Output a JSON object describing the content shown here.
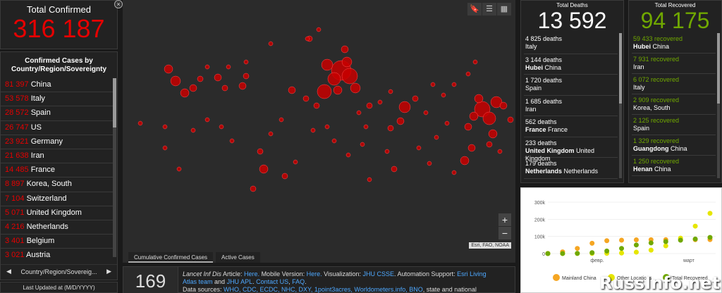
{
  "total_confirmed": {
    "label": "Total Confirmed",
    "value": "316 187"
  },
  "cases": {
    "header": "Confirmed Cases by Country/Region/Sovereignty",
    "rows": [
      {
        "n": "81 397",
        "c": "China"
      },
      {
        "n": "53 578",
        "c": "Italy"
      },
      {
        "n": "28 572",
        "c": "Spain"
      },
      {
        "n": "26 747",
        "c": "US"
      },
      {
        "n": "23 921",
        "c": "Germany"
      },
      {
        "n": "21 638",
        "c": "Iran"
      },
      {
        "n": "14 485",
        "c": "France"
      },
      {
        "n": "8 897",
        "c": "Korea, South"
      },
      {
        "n": "7 104",
        "c": "Switzerland"
      },
      {
        "n": "5 071",
        "c": "United Kingdom"
      },
      {
        "n": "4 216",
        "c": "Netherlands"
      },
      {
        "n": "3 401",
        "c": "Belgium"
      },
      {
        "n": "3 021",
        "c": "Austria"
      }
    ],
    "nav_label": "Country/Region/Sovereig..."
  },
  "last_updated": "Last Updated at (M/D/YYYY)",
  "map": {
    "attribution": "Esri, FAO, NOAA",
    "tabs": [
      "Cumulative Confirmed Cases",
      "Active Cases"
    ],
    "zoom_in": "+",
    "zoom_out": "−"
  },
  "ticker": {
    "count": "169",
    "line1_a": "Lancet Inf Dis",
    "line1_b": " Article: ",
    "here": "Here.",
    "mobile": " Mobile Version: ",
    "vis": " Visualization: ",
    "jhu": "JHU CSSE",
    "auto": ". Automation Support: ",
    "esri": "Esri Living Atlas team",
    "and": " and ",
    "apl": "JHU APL",
    "contact": "Contact US",
    "faq": "FAQ",
    "sources": "Data sources: ",
    "sourcelinks": "WHO, CDC, ECDC, NHC, DXY, 1point3acres, Worldometers.info, BNO",
    "sources_tail": ", state and national"
  },
  "deaths": {
    "label": "Total Deaths",
    "value": "13 592",
    "rows": [
      {
        "n": "4 825 deaths",
        "place": "",
        "country": "Italy"
      },
      {
        "n": "3 144 deaths",
        "place": "Hubei",
        "country": "China"
      },
      {
        "n": "1 720 deaths",
        "place": "",
        "country": "Spain"
      },
      {
        "n": "1 685 deaths",
        "place": "",
        "country": "Iran"
      },
      {
        "n": "562 deaths",
        "place": "France",
        "country": "France"
      },
      {
        "n": "233 deaths",
        "place": "United Kingdom",
        "country": "United Kingdom"
      },
      {
        "n": "179 deaths",
        "place": "Netherlands",
        "country": "Netherlands"
      }
    ]
  },
  "recovered": {
    "label": "Total Recovered",
    "value": "94 175",
    "rows": [
      {
        "n": "59 433 recovered",
        "place": "Hubei",
        "country": "China"
      },
      {
        "n": "7 931 recovered",
        "place": "",
        "country": "Iran"
      },
      {
        "n": "6 072 recovered",
        "place": "",
        "country": "Italy"
      },
      {
        "n": "2 909 recovered",
        "place": "",
        "country": "Korea, South"
      },
      {
        "n": "2 125 recovered",
        "place": "",
        "country": "Spain"
      },
      {
        "n": "1 329 recovered",
        "place": "Guangdong",
        "country": "China"
      },
      {
        "n": "1 250 recovered",
        "place": "Henan",
        "country": "China"
      }
    ]
  },
  "colors": {
    "confirmed": "#e60000",
    "recovered": "#70a800",
    "mainland": "#f5a623",
    "other": "#e6e600",
    "recovered_line": "#70a800"
  },
  "watermark": "RussInfo.net",
  "chart_data": {
    "type": "line",
    "yticks": [
      "300k",
      "200k",
      "100k",
      "0"
    ],
    "ylim": [
      0,
      300000
    ],
    "xticks": [
      "февр.",
      "март"
    ],
    "series": [
      {
        "name": "Mainland China",
        "values": [
          500,
          10000,
          30000,
          60000,
          75000,
          78000,
          80000,
          80500,
          81000,
          81200,
          81300,
          81397
        ]
      },
      {
        "name": "Other Locations",
        "values": [
          100,
          200,
          500,
          1000,
          1500,
          3000,
          8000,
          20000,
          45000,
          90000,
          160000,
          234790
        ]
      },
      {
        "name": "Total Recovered",
        "values": [
          0,
          200,
          1000,
          5000,
          15000,
          30000,
          50000,
          62000,
          70000,
          78000,
          85000,
          94175
        ]
      }
    ]
  }
}
